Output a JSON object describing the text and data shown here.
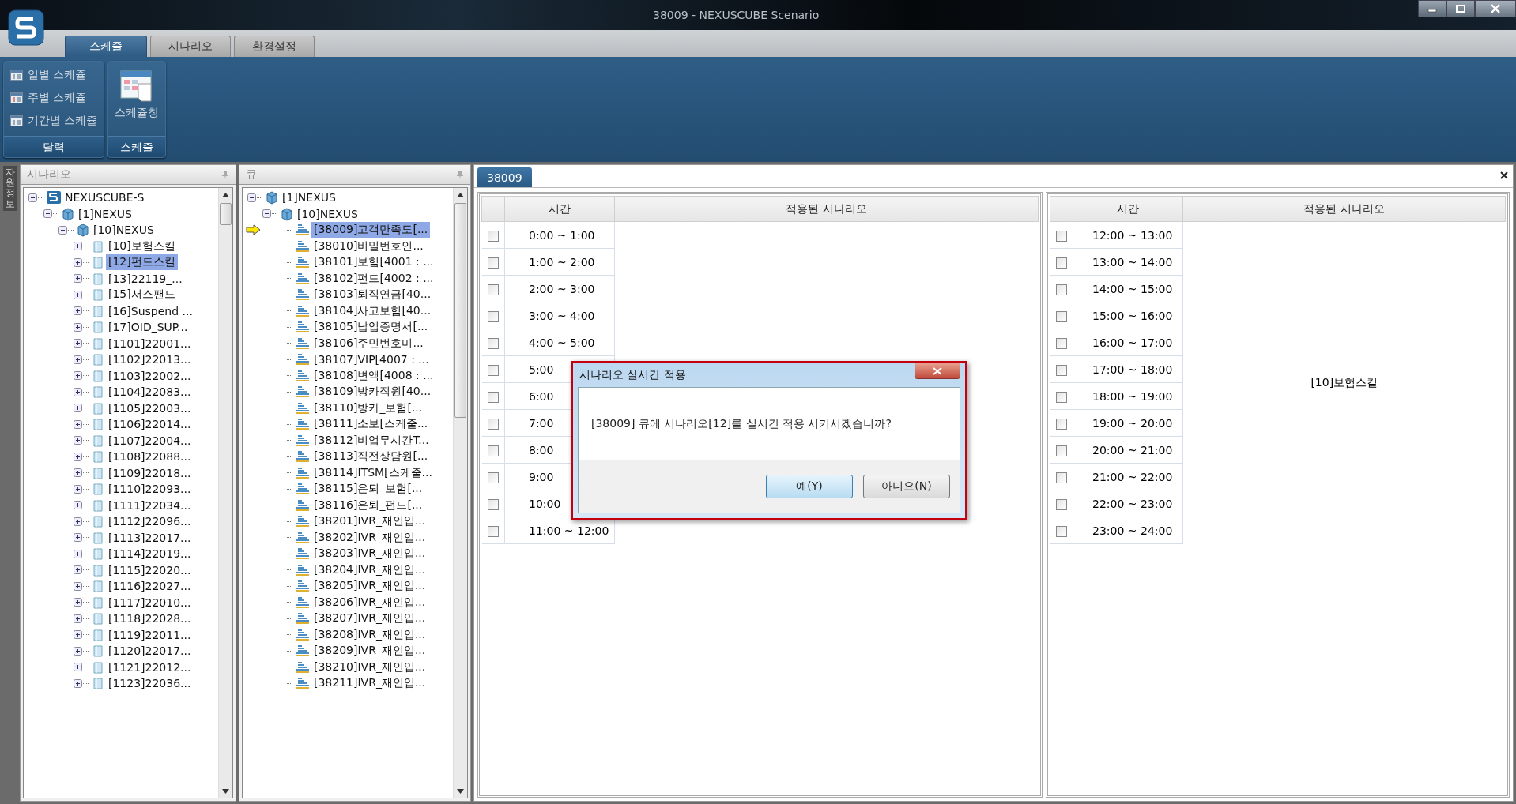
{
  "window": {
    "title": "38009 - NEXUSCUBE Scenario"
  },
  "ribbon": {
    "tabs": [
      {
        "label": "스케쥴",
        "selected": true
      },
      {
        "label": "시나리오",
        "selected": false
      },
      {
        "label": "환경설정",
        "selected": false
      }
    ],
    "groups": [
      {
        "label": "달력",
        "items": [
          {
            "label": "일별 스케쥴",
            "kind": "small"
          },
          {
            "label": "주별 스케쥴",
            "kind": "small"
          },
          {
            "label": "기간별 스케쥴",
            "kind": "small"
          }
        ]
      },
      {
        "label": "스케쥴",
        "items": [
          {
            "label": "스케쥴창",
            "kind": "large"
          }
        ]
      }
    ]
  },
  "side_tab": {
    "label": "자원정보"
  },
  "scenario_panel": {
    "title": "시나리오",
    "tree": [
      {
        "label": "NEXUSCUBE-S",
        "kind": "root",
        "expanded": true,
        "selected": false,
        "children": [
          {
            "label": "[1]NEXUS",
            "kind": "server",
            "expanded": true,
            "selected": false,
            "children": [
              {
                "label": "[10]NEXUS",
                "kind": "server",
                "expanded": true,
                "selected": false,
                "children": [
                  {
                    "label": "[10]보험스킬",
                    "kind": "skill",
                    "expanded": false,
                    "selected": false
                  },
                  {
                    "label": "[12]펀드스킬",
                    "kind": "skill",
                    "expanded": false,
                    "selected": true
                  },
                  {
                    "label": "[13]22119_...",
                    "kind": "skill",
                    "expanded": false,
                    "selected": false
                  },
                  {
                    "label": "[15]서스팬드",
                    "kind": "skill",
                    "expanded": false,
                    "selected": false
                  },
                  {
                    "label": "[16]Suspend ...",
                    "kind": "skill",
                    "expanded": false,
                    "selected": false
                  },
                  {
                    "label": "[17]OID_SUP...",
                    "kind": "skill",
                    "expanded": false,
                    "selected": false
                  },
                  {
                    "label": "[1101]22001...",
                    "kind": "skill",
                    "expanded": false,
                    "selected": false
                  },
                  {
                    "label": "[1102]22013...",
                    "kind": "skill",
                    "expanded": false,
                    "selected": false
                  },
                  {
                    "label": "[1103]22002...",
                    "kind": "skill",
                    "expanded": false,
                    "selected": false
                  },
                  {
                    "label": "[1104]22083...",
                    "kind": "skill",
                    "expanded": false,
                    "selected": false
                  },
                  {
                    "label": "[1105]22003...",
                    "kind": "skill",
                    "expanded": false,
                    "selected": false
                  },
                  {
                    "label": "[1106]22014...",
                    "kind": "skill",
                    "expanded": false,
                    "selected": false
                  },
                  {
                    "label": "[1107]22004...",
                    "kind": "skill",
                    "expanded": false,
                    "selected": false
                  },
                  {
                    "label": "[1108]22088...",
                    "kind": "skill",
                    "expanded": false,
                    "selected": false
                  },
                  {
                    "label": "[1109]22018...",
                    "kind": "skill",
                    "expanded": false,
                    "selected": false
                  },
                  {
                    "label": "[1110]22093...",
                    "kind": "skill",
                    "expanded": false,
                    "selected": false
                  },
                  {
                    "label": "[1111]22034...",
                    "kind": "skill",
                    "expanded": false,
                    "selected": false
                  },
                  {
                    "label": "[1112]22096...",
                    "kind": "skill",
                    "expanded": false,
                    "selected": false
                  },
                  {
                    "label": "[1113]22017...",
                    "kind": "skill",
                    "expanded": false,
                    "selected": false
                  },
                  {
                    "label": "[1114]22019...",
                    "kind": "skill",
                    "expanded": false,
                    "selected": false
                  },
                  {
                    "label": "[1115]22020...",
                    "kind": "skill",
                    "expanded": false,
                    "selected": false
                  },
                  {
                    "label": "[1116]22027...",
                    "kind": "skill",
                    "expanded": false,
                    "selected": false
                  },
                  {
                    "label": "[1117]22010...",
                    "kind": "skill",
                    "expanded": false,
                    "selected": false
                  },
                  {
                    "label": "[1118]22028...",
                    "kind": "skill",
                    "expanded": false,
                    "selected": false
                  },
                  {
                    "label": "[1119]22011...",
                    "kind": "skill",
                    "expanded": false,
                    "selected": false
                  },
                  {
                    "label": "[1120]22017...",
                    "kind": "skill",
                    "expanded": false,
                    "selected": false
                  },
                  {
                    "label": "[1121]22012...",
                    "kind": "skill",
                    "expanded": false,
                    "selected": false
                  },
                  {
                    "label": "[1123]22036...",
                    "kind": "skill",
                    "expanded": false,
                    "selected": false
                  }
                ]
              }
            ]
          }
        ]
      }
    ]
  },
  "queue_panel": {
    "title": "큐",
    "tree": [
      {
        "label": "[1]NEXUS",
        "kind": "server",
        "expanded": true,
        "selected": false,
        "children": [
          {
            "label": "[10]NEXUS",
            "kind": "server",
            "expanded": true,
            "selected": false,
            "children": [
              {
                "label": "[38009]고객만족도[...",
                "kind": "queue",
                "selected": true,
                "marked": true
              },
              {
                "label": "[38010]비밀번호인...",
                "kind": "queue",
                "selected": false,
                "marked": false
              },
              {
                "label": "[38101]보험[4001 : ...",
                "kind": "queue",
                "selected": false,
                "marked": false
              },
              {
                "label": "[38102]펀드[4002 : ...",
                "kind": "queue",
                "selected": false,
                "marked": false
              },
              {
                "label": "[38103]퇴직연금[40...",
                "kind": "queue",
                "selected": false,
                "marked": false
              },
              {
                "label": "[38104]사고보험[40...",
                "kind": "queue",
                "selected": false,
                "marked": false
              },
              {
                "label": "[38105]납입증명서[...",
                "kind": "queue",
                "selected": false,
                "marked": false
              },
              {
                "label": "[38106]주민번호미...",
                "kind": "queue",
                "selected": false,
                "marked": false
              },
              {
                "label": "[38107]VIP[4007 : ...",
                "kind": "queue",
                "selected": false,
                "marked": false
              },
              {
                "label": "[38108]변액[4008 : ...",
                "kind": "queue",
                "selected": false,
                "marked": false
              },
              {
                "label": "[38109]방카직원[40...",
                "kind": "queue",
                "selected": false,
                "marked": false
              },
              {
                "label": "[38110]방카_보험[...",
                "kind": "queue",
                "selected": false,
                "marked": false
              },
              {
                "label": "[38111]소보[스케줄...",
                "kind": "queue",
                "selected": false,
                "marked": false
              },
              {
                "label": "[38112]비업무시간T...",
                "kind": "queue",
                "selected": false,
                "marked": false
              },
              {
                "label": "[38113]직전상담원[...",
                "kind": "queue",
                "selected": false,
                "marked": false
              },
              {
                "label": "[38114]ITSM[스케줄...",
                "kind": "queue",
                "selected": false,
                "marked": false
              },
              {
                "label": "[38115]은퇴_보험[...",
                "kind": "queue",
                "selected": false,
                "marked": false
              },
              {
                "label": "[38116]은퇴_펀드[...",
                "kind": "queue",
                "selected": false,
                "marked": false
              },
              {
                "label": "[38201]IVR_재인입...",
                "kind": "queue",
                "selected": false,
                "marked": false
              },
              {
                "label": "[38202]IVR_재인입...",
                "kind": "queue",
                "selected": false,
                "marked": false
              },
              {
                "label": "[38203]IVR_재인입...",
                "kind": "queue",
                "selected": false,
                "marked": false
              },
              {
                "label": "[38204]IVR_재인입...",
                "kind": "queue",
                "selected": false,
                "marked": false
              },
              {
                "label": "[38205]IVR_재인입...",
                "kind": "queue",
                "selected": false,
                "marked": false
              },
              {
                "label": "[38206]IVR_재인입...",
                "kind": "queue",
                "selected": false,
                "marked": false
              },
              {
                "label": "[38207]IVR_재인입...",
                "kind": "queue",
                "selected": false,
                "marked": false
              },
              {
                "label": "[38208]IVR_재인입...",
                "kind": "queue",
                "selected": false,
                "marked": false
              },
              {
                "label": "[38209]IVR_재인입...",
                "kind": "queue",
                "selected": false,
                "marked": false
              },
              {
                "label": "[38210]IVR_재인입...",
                "kind": "queue",
                "selected": false,
                "marked": false
              },
              {
                "label": "[38211]IVR_재인입...",
                "kind": "queue",
                "selected": false,
                "marked": false
              }
            ]
          }
        ]
      }
    ]
  },
  "document_tab": {
    "label": "38009",
    "selected": true
  },
  "schedule_tables": [
    {
      "columns": [
        "시간",
        "적용된 시나리오"
      ],
      "rows": [
        {
          "time": "0:00 ~ 1:00",
          "checked": false
        },
        {
          "time": "1:00 ~ 2:00",
          "checked": false
        },
        {
          "time": "2:00 ~ 3:00",
          "checked": false
        },
        {
          "time": "3:00 ~ 4:00",
          "checked": false
        },
        {
          "time": "4:00 ~ 5:00",
          "checked": false
        },
        {
          "time": "5:00",
          "checked": false
        },
        {
          "time": "6:00",
          "checked": false
        },
        {
          "time": "7:00",
          "checked": false
        },
        {
          "time": "8:00",
          "checked": false
        },
        {
          "time": "9:00",
          "checked": false
        },
        {
          "time": "10:00",
          "checked": false
        },
        {
          "time": "11:00 ~ 12:00",
          "checked": false
        }
      ]
    },
    {
      "columns": [
        "시간",
        "적용된 시나리오"
      ],
      "applied_scenario": "[10]보험스킬",
      "rows": [
        {
          "time": "12:00 ~ 13:00",
          "checked": false
        },
        {
          "time": "13:00 ~ 14:00",
          "checked": false
        },
        {
          "time": "14:00 ~ 15:00",
          "checked": false
        },
        {
          "time": "15:00 ~ 16:00",
          "checked": false
        },
        {
          "time": "16:00 ~ 17:00",
          "checked": false
        },
        {
          "time": "17:00 ~ 18:00",
          "checked": false
        },
        {
          "time": "18:00 ~ 19:00",
          "checked": false
        },
        {
          "time": "19:00 ~ 20:00",
          "checked": false
        },
        {
          "time": "20:00 ~ 21:00",
          "checked": false
        },
        {
          "time": "21:00 ~ 22:00",
          "checked": false
        },
        {
          "time": "22:00 ~ 23:00",
          "checked": false
        },
        {
          "time": "23:00 ~ 24:00",
          "checked": false
        }
      ]
    }
  ],
  "dialog": {
    "title": "시나리오 실시간 적용",
    "message": "[38009] 큐에 시나리오[12]를 실시간 적용 시키시겠습니까?",
    "buttons": [
      {
        "label": "예(Y)",
        "selected": true
      },
      {
        "label": "아니요(N)",
        "selected": false
      }
    ]
  }
}
